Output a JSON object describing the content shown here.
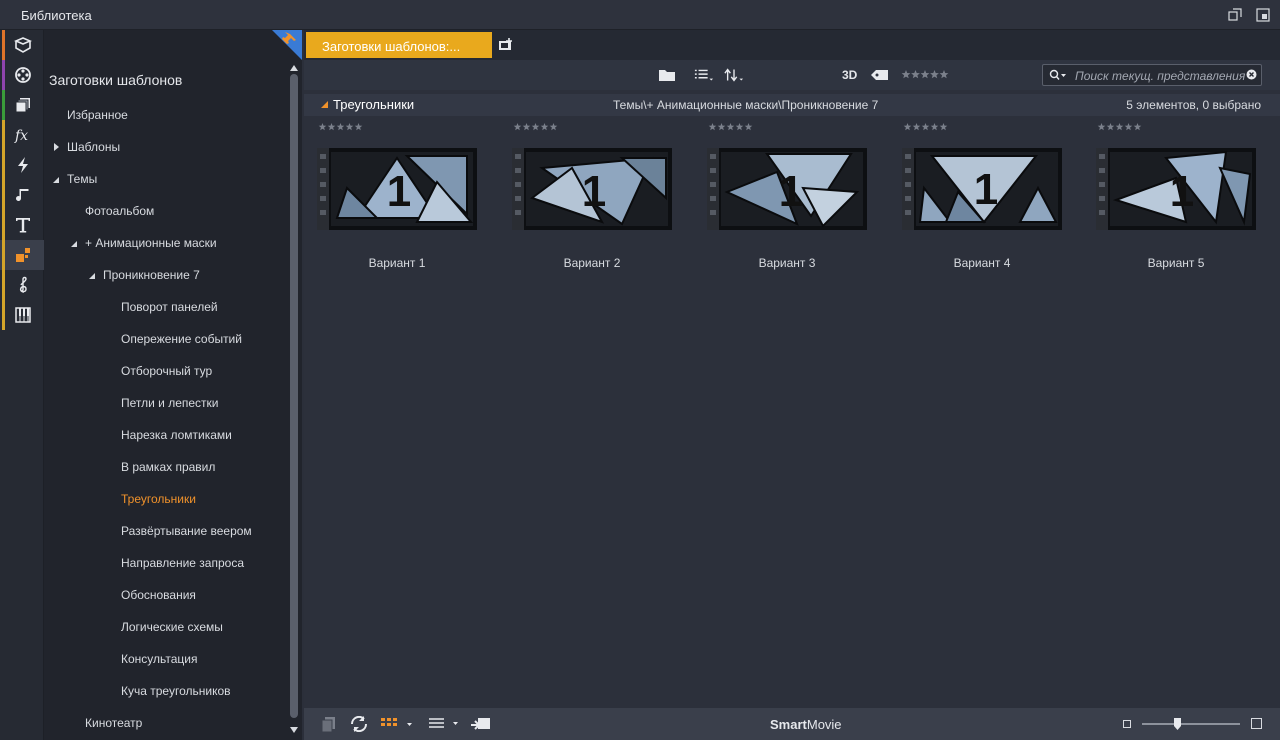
{
  "window": {
    "title": "Библиотека"
  },
  "tree": {
    "heading": "Заготовки шаблонов",
    "nodes": [
      {
        "label": "Избранное"
      },
      {
        "label": "Шаблоны"
      },
      {
        "label": "Темы"
      },
      {
        "label": "Фотоальбом"
      },
      {
        "label": "+ Анимационные маски"
      },
      {
        "label": "Проникновение 7"
      },
      {
        "label": "Поворот панелей"
      },
      {
        "label": "Опережение событий"
      },
      {
        "label": "Отборочный тур"
      },
      {
        "label": "Петли и лепестки"
      },
      {
        "label": "Нарезка ломтиками"
      },
      {
        "label": "В рамках правил"
      },
      {
        "label": "Треугольники"
      },
      {
        "label": "Развёртывание веером"
      },
      {
        "label": "Направление запроса"
      },
      {
        "label": "Обоснования"
      },
      {
        "label": "Логические схемы"
      },
      {
        "label": "Консультация"
      },
      {
        "label": "Куча треугольников"
      },
      {
        "label": "Кинотеатр"
      }
    ]
  },
  "rail_icons": [
    "box-icon",
    "film-reel-icon",
    "collection-icon",
    "fx-icon",
    "lightning-icon",
    "music-note-icon",
    "text-t-icon",
    "blocks-icon",
    "treble-clef-icon",
    "piano-icon"
  ],
  "rail_colors": [
    "#e0742a",
    "#8e44ad",
    "#3a9c3a",
    "#d4a52a",
    "#d4a52a",
    "#d4a52a",
    "#d4a52a",
    "#d4a52a",
    "#d4a52a",
    "#d4a52a"
  ],
  "tab": {
    "label": "Заготовки шаблонов:..."
  },
  "toolbar": {
    "label_3d": "3D",
    "search_placeholder": "Поиск текущ. представления"
  },
  "group": {
    "title": "Треугольники",
    "path": "Темы\\+ Анимационные маски\\Проникновение 7",
    "count": "5 элементов, 0 выбрано"
  },
  "items": [
    {
      "label": "Вариант 1",
      "number": "1"
    },
    {
      "label": "Вариант 2",
      "number": "1"
    },
    {
      "label": "Вариант 3",
      "number": "1"
    },
    {
      "label": "Вариант 4",
      "number": "1"
    },
    {
      "label": "Вариант 5",
      "number": "1"
    }
  ],
  "bottom": {
    "brand_bold": "Smart",
    "brand_regular": "Movie"
  },
  "colors": {
    "accent": "#e9a91d",
    "selected": "#f0922b",
    "panel": "#2c303b"
  }
}
